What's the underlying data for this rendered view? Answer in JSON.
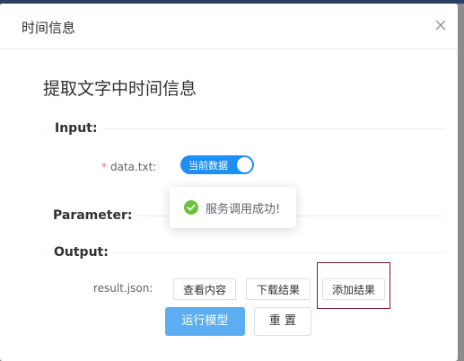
{
  "dialog": {
    "title": "时间信息",
    "heading": "提取文字中时间信息"
  },
  "sections": {
    "input": "Input:",
    "parameter": "Parameter:",
    "output": "Output:"
  },
  "input": {
    "required_mark": "*",
    "field_label": "data.txt:",
    "switch_label": "当前数据",
    "switch_on": true
  },
  "toast": {
    "message": "服务调用成功!",
    "icon": "check-circle-icon",
    "color": "#67c23a"
  },
  "output": {
    "field_label": "result.json:",
    "buttons": [
      "查看内容",
      "下载结果",
      "添加结果"
    ]
  },
  "actions": {
    "run_label": "运行模型",
    "reset_label": "重 置"
  },
  "colors": {
    "primary": "#1f8ff5",
    "run_button": "#5dadf2",
    "highlight_border": "#7a1e2e"
  }
}
